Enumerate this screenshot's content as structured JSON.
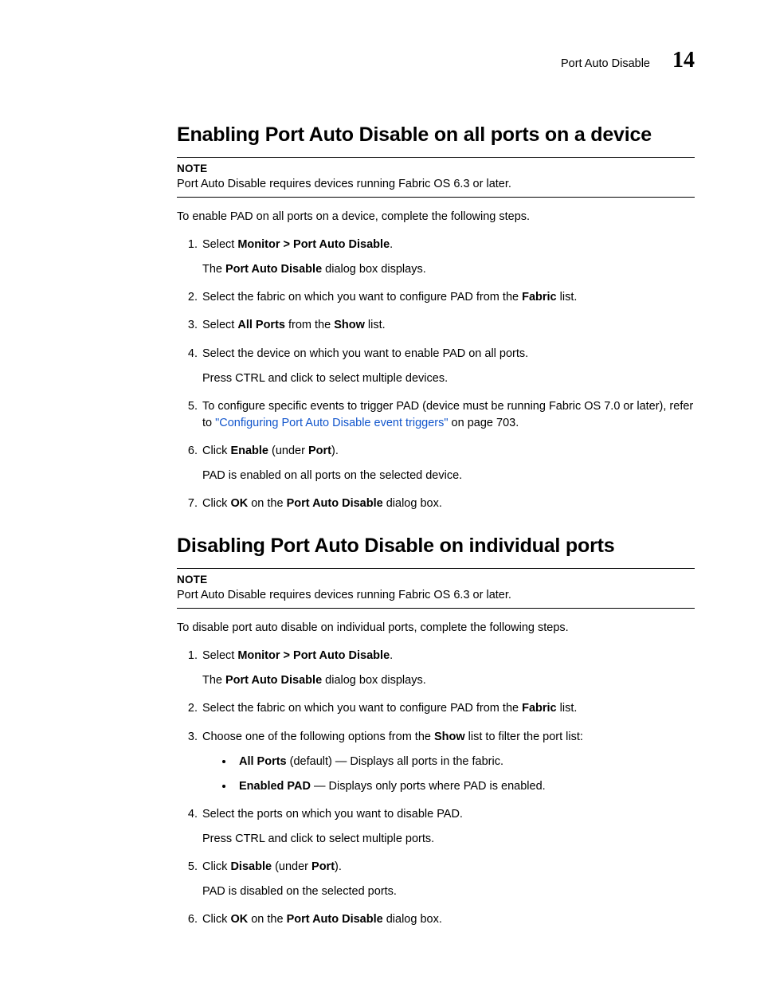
{
  "header": {
    "title": "Port Auto Disable",
    "chapter": "14"
  },
  "section1": {
    "heading": "Enabling Port Auto Disable on all ports on a device",
    "note_label": "NOTE",
    "note_text": "Port Auto Disable requires devices running Fabric OS 6.3 or later.",
    "intro": "To enable PAD on all ports on a device, complete the following steps.",
    "steps": {
      "s1": {
        "pre": "Select ",
        "bold": "Monitor > Port Auto Disable",
        "post": ".",
        "sub_pre": "The ",
        "sub_bold": "Port Auto Disable",
        "sub_post": " dialog box displays."
      },
      "s2": {
        "pre": "Select the fabric on which you want to configure PAD from the ",
        "bold": "Fabric",
        "post": " list."
      },
      "s3": {
        "pre": "Select ",
        "bold1": "All Ports",
        "mid": " from the ",
        "bold2": "Show",
        "post": " list."
      },
      "s4": {
        "text": "Select the device on which you want to enable PAD on all ports.",
        "sub": "Press CTRL and click to select multiple devices."
      },
      "s5": {
        "pre": "To configure specific events to trigger PAD (device must be running Fabric OS 7.0 or later), refer to ",
        "link": "\"Configuring Port Auto Disable event triggers\"",
        "post": " on page 703."
      },
      "s6": {
        "pre": "Click ",
        "bold1": "Enable",
        "mid": " (under ",
        "bold2": "Port",
        "post": ").",
        "sub": "PAD is enabled on all ports on the selected device."
      },
      "s7": {
        "pre": "Click ",
        "bold1": "OK",
        "mid": " on the ",
        "bold2": "Port Auto Disable",
        "post": " dialog box."
      }
    }
  },
  "section2": {
    "heading": "Disabling Port Auto Disable on individual ports",
    "note_label": "NOTE",
    "note_text": "Port Auto Disable requires devices running Fabric OS 6.3 or later.",
    "intro": "To disable port auto disable on individual ports, complete the following steps.",
    "steps": {
      "s1": {
        "pre": "Select ",
        "bold": "Monitor > Port Auto Disable",
        "post": ".",
        "sub_pre": "The ",
        "sub_bold": "Port Auto Disable",
        "sub_post": " dialog box displays."
      },
      "s2": {
        "pre": "Select the fabric on which you want to configure PAD from the ",
        "bold": "Fabric",
        "post": " list."
      },
      "s3": {
        "pre": "Choose one of the following options from the ",
        "bold": "Show",
        "post": " list to filter the port list:",
        "b1_bold": "All Ports",
        "b1_post": " (default) — Displays all ports in the fabric.",
        "b2_bold": "Enabled PAD",
        "b2_post": " — Displays only ports where PAD is enabled."
      },
      "s4": {
        "text": "Select the ports on which you want to disable PAD.",
        "sub": "Press CTRL and click to select multiple ports."
      },
      "s5": {
        "pre": "Click ",
        "bold1": "Disable",
        "mid": " (under ",
        "bold2": "Port",
        "post": ").",
        "sub": "PAD is disabled on the selected ports."
      },
      "s6": {
        "pre": "Click ",
        "bold1": "OK",
        "mid": " on the ",
        "bold2": "Port Auto Disable",
        "post": " dialog box."
      }
    }
  }
}
